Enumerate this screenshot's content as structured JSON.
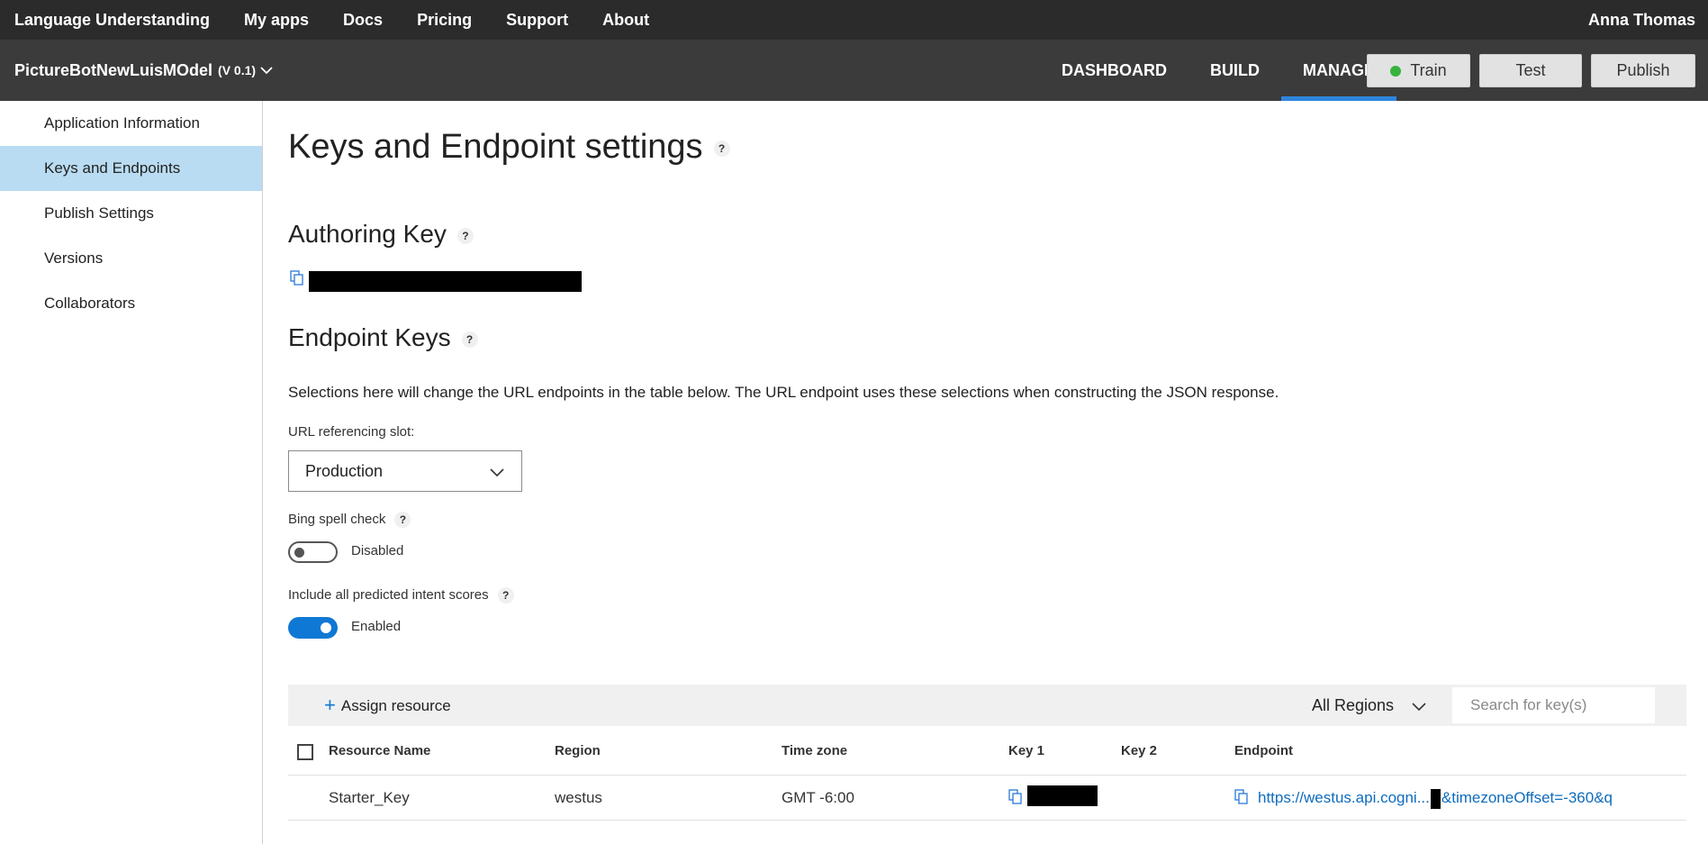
{
  "topnav": {
    "items": [
      "Language Understanding",
      "My apps",
      "Docs",
      "Pricing",
      "Support",
      "About"
    ],
    "user": "Anna Thomas"
  },
  "appbar": {
    "app_name": "PictureBotNewLuisMOdel",
    "version": "(V 0.1)",
    "tabs": [
      "DASHBOARD",
      "BUILD",
      "MANAGE"
    ],
    "active_tab": "MANAGE",
    "train_label": "Train",
    "test_label": "Test",
    "publish_label": "Publish"
  },
  "sidebar": {
    "items": [
      {
        "label": "Application Information"
      },
      {
        "label": "Keys and Endpoints"
      },
      {
        "label": "Publish Settings"
      },
      {
        "label": "Versions"
      },
      {
        "label": "Collaborators"
      }
    ],
    "active": "Keys and Endpoints"
  },
  "main": {
    "title": "Keys and Endpoint settings",
    "authoring_heading": "Authoring Key",
    "endpoint_heading": "Endpoint Keys",
    "description": "Selections here will change the URL endpoints in the table below. The URL endpoint uses these selections when constructing the JSON response.",
    "slot_label": "URL referencing slot:",
    "slot_value": "Production",
    "spell_label": "Bing spell check",
    "spell_state": "Disabled",
    "intent_label": "Include all predicted intent scores",
    "intent_state": "Enabled"
  },
  "toolbar": {
    "assign_label": "Assign resource",
    "regions_label": "All Regions",
    "search_placeholder": "Search for key(s)"
  },
  "table": {
    "columns": [
      "Resource Name",
      "Region",
      "Time zone",
      "Key 1",
      "Key 2",
      "Endpoint"
    ],
    "rows": [
      {
        "resource": "Starter_Key",
        "region": "westus",
        "timezone": "GMT -6:00",
        "endpoint_prefix": "https://westus.api.cogni...",
        "endpoint_suffix": "&timezoneOffset=-360&q"
      }
    ]
  },
  "colors": {
    "topnav_bg": "#2b2b2b",
    "appbar_bg": "#3b3b3b",
    "accent": "#0f78d4",
    "active_sidebar": "#b9dcf2",
    "train_dot": "#36b33c"
  }
}
